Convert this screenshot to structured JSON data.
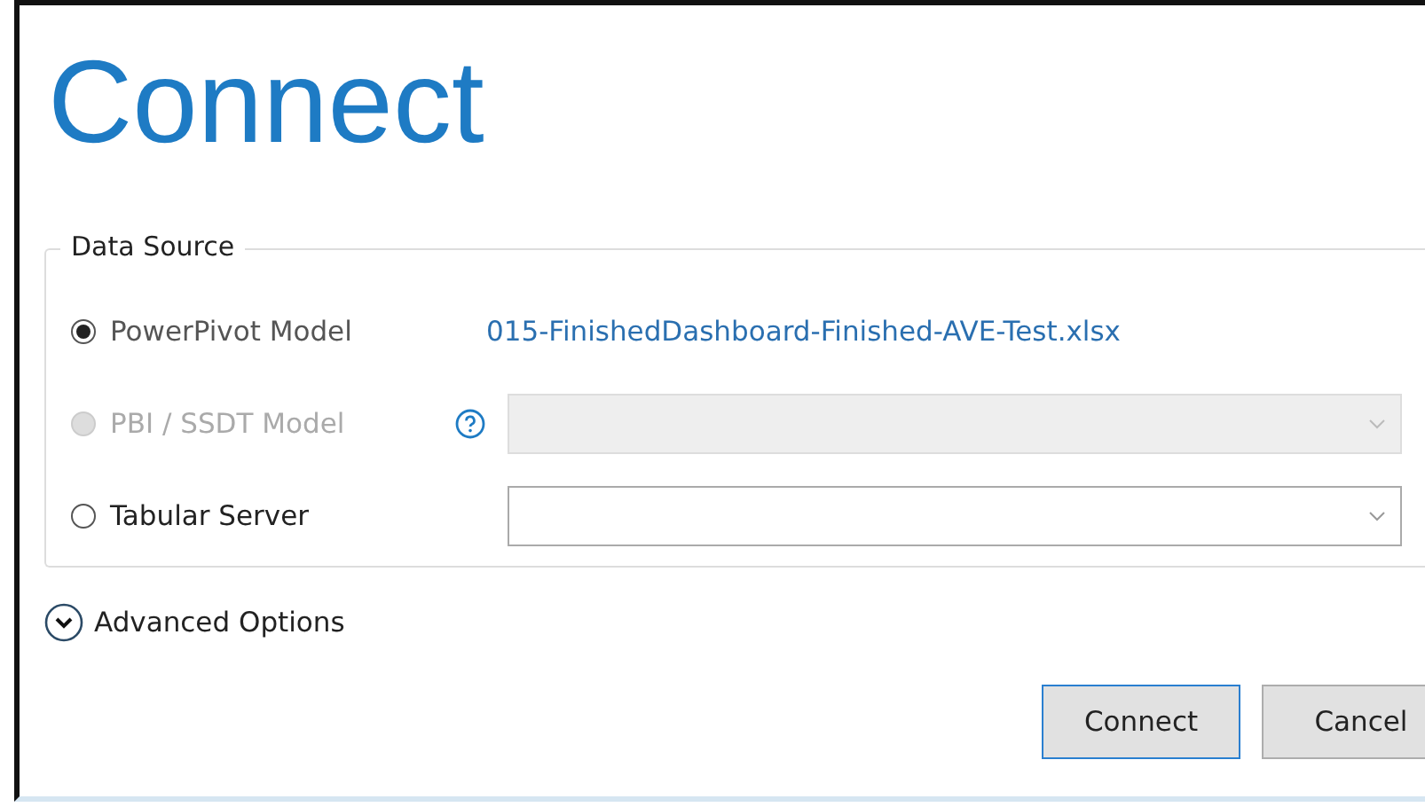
{
  "title": "Connect",
  "data_source": {
    "legend": "Data Source",
    "options": [
      {
        "label": "PowerPivot Model",
        "selected": true,
        "disabled": false,
        "kind": "file",
        "value": "015-FinishedDashboard-Finished-AVE-Test.xlsx"
      },
      {
        "label": "PBI / SSDT Model",
        "selected": false,
        "disabled": true,
        "kind": "dropdown",
        "help": true
      },
      {
        "label": "Tabular Server",
        "selected": false,
        "disabled": false,
        "kind": "dropdown",
        "help": false
      }
    ]
  },
  "advanced": {
    "label": "Advanced Options",
    "expanded": false
  },
  "buttons": [
    {
      "label": "Connect",
      "default": true
    },
    {
      "label": "Cancel",
      "default": false
    }
  ]
}
